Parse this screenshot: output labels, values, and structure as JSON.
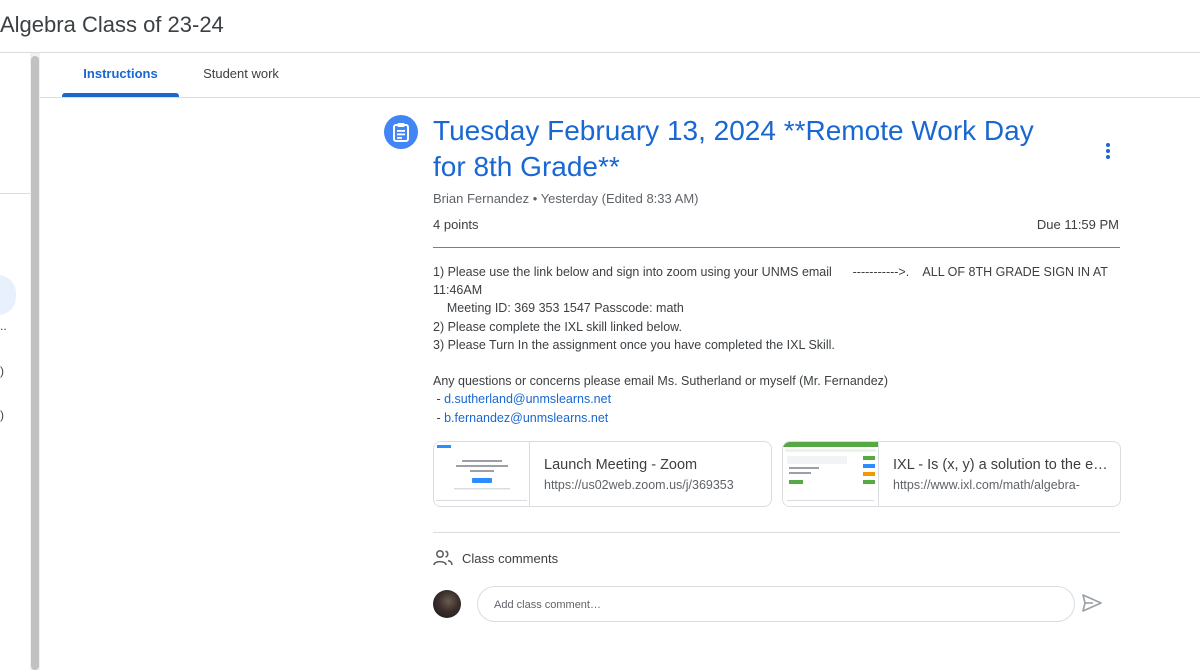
{
  "header": {
    "class_title": "Algebra Class of 23-24"
  },
  "left_rail": {
    "text_1": "..",
    "text_2": ")",
    "text_3": ")"
  },
  "tabs": [
    {
      "label": "Instructions",
      "active": true
    },
    {
      "label": "Student work",
      "active": false
    }
  ],
  "assignment": {
    "title": "Tuesday February 13, 2024 **Remote Work Day for 8th Grade**",
    "author": "Brian Fernandez",
    "separator": "•",
    "posted": "Yesterday (Edited 8:33 AM)",
    "points": "4 points",
    "due": "Due 11:59 PM",
    "body_lines": [
      "1) Please use the link below and sign into zoom using your UNMS email      ----------->.    ALL OF 8TH GRADE SIGN IN AT",
      "11:46AM",
      "    Meeting ID: 369 353 1547 Passcode: math",
      "2) Please complete the IXL skill linked below.",
      "3) Please Turn In the assignment once you have completed the IXL Skill.",
      "",
      "Any questions or concerns please email Ms. Sutherland or myself (Mr. Fernandez)"
    ],
    "emails": [
      {
        "prefix": " - ",
        "address": "d.sutherland@unmslearns.net"
      },
      {
        "prefix": " - ",
        "address": "b.fernandez@unmslearns.net"
      }
    ]
  },
  "attachments": [
    {
      "title": "Launch Meeting - Zoom",
      "url": "https://us02web.zoom.us/j/369353"
    },
    {
      "title": "IXL - Is (x, y) a solution to the equation?",
      "url": "https://www.ixl.com/math/algebra-"
    }
  ],
  "comments": {
    "label": "Class comments",
    "placeholder": "Add class comment…"
  },
  "colors": {
    "accent": "#1967d2",
    "icon_bg": "#4285f4",
    "divider": "#dadce0"
  }
}
